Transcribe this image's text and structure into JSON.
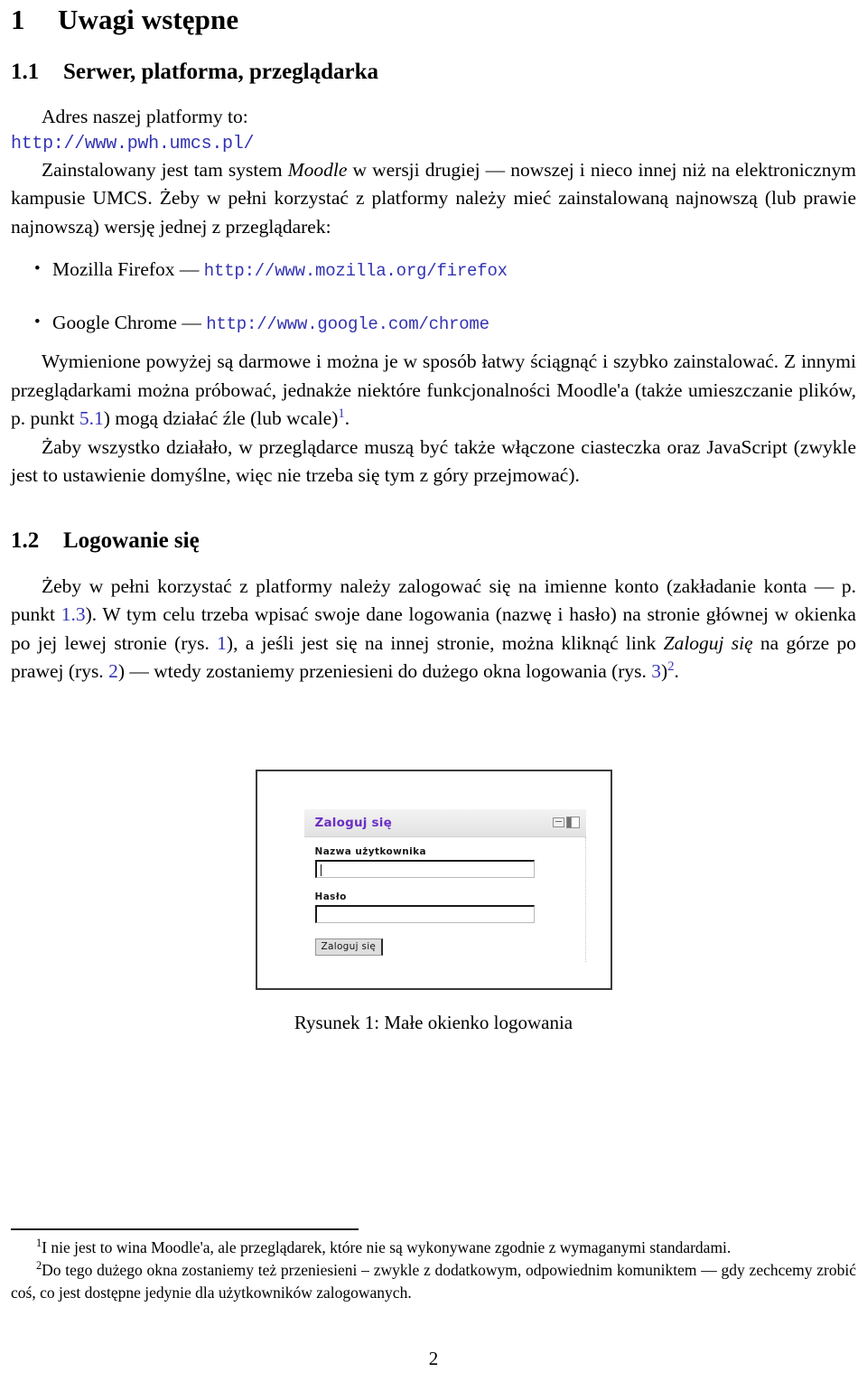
{
  "document": {
    "page_number": "2"
  },
  "section1": {
    "number": "1",
    "title": "Uwagi wstępne"
  },
  "subsection11": {
    "number": "1.1",
    "title": "Serwer, platforma, przeglądarka",
    "intro": "Adres naszej platformy to:",
    "platform_url": "http://www.pwh.umcs.pl/",
    "para1_a": "Zainstalowany jest tam system ",
    "para1_moodle": "Moodle",
    "para1_b": " w wersji drugiej — nowszej i nieco innej niż na elektronicznym kampusie UMCS. Żeby w pełni korzystać z platformy należy mieć zainstalowaną najnowszą (lub prawie najnowszą) wersję jednej z przeglądarek:",
    "browsers": [
      {
        "name": "Mozilla Firefox",
        "dash": " — ",
        "url": "http://www.mozilla.org/firefox"
      },
      {
        "name": "Google Chrome",
        "dash": " — ",
        "url": "http://www.google.com/chrome"
      }
    ],
    "para2_a": "Wymienione powyżej są darmowe i można je w sposób łatwy ściągnąć i szybko zainstalować. Z innymi przeglądarkami można próbować, jednakże niektóre funkcjonalności Moodle'a (także umieszczanie plików, p. punkt ",
    "para2_ref": "5.1",
    "para2_b": ") mogą działać źle (lub wcale)",
    "para2_fn": "1",
    "para2_c": ".",
    "para3": "Żaby wszystko działało, w przeglądarce muszą być także włączone ciasteczka oraz JavaScript (zwykle jest to ustawienie domyślne, więc nie trzeba się tym z góry przejmować)."
  },
  "subsection12": {
    "number": "1.2",
    "title": "Logowanie się",
    "para_a": "Żeby w pełni korzystać z platformy należy zalogować się na imienne konto (zakładanie konta — p. punkt ",
    "ref_13": "1.3",
    "para_b": "). W tym celu trzeba wpisać swoje dane logowania (nazwę i hasło) na stronie głównej w okienka po jej lewej stronie (rys. ",
    "ref_rys1": "1",
    "para_c": "), a jeśli jest się na innej stronie, można kliknąć link ",
    "link_italic": "Zaloguj się",
    "para_d": " na górze po prawej (rys. ",
    "ref_rys2": "2",
    "para_e": ") — wtedy zostaniemy przeniesieni do dużego okna logowania (rys. ",
    "ref_rys3": "3",
    "para_f": ")",
    "para_fn": "2",
    "para_g": "."
  },
  "figure": {
    "caption": "Rysunek 1: Małe okienko logowania",
    "login_panel": {
      "title": "Zaloguj się",
      "username_label": "Nazwa użytkownika",
      "username_value": "",
      "password_label": "Hasło",
      "password_value": "",
      "submit_label": "Zaloguj się",
      "minimize_icon": "minimize-icon",
      "dock_icon": "dock-columns-icon",
      "title_color": "#6a2fc4"
    }
  },
  "footnotes": [
    {
      "mark": "1",
      "text": "I nie jest to wina Moodle'a, ale przeglądarek, które nie są wykonywane zgodnie z wymaganymi standardami."
    },
    {
      "mark": "2",
      "text": "Do tego dużego okna zostaniemy też przeniesieni – zwykle z dodatkowym, odpowiednim komuniktem — gdy zechcemy zrobić coś, co jest dostępne jedynie dla użytkowników zalogowanych."
    }
  ],
  "colors": {
    "link": "#3333b3",
    "panel_title": "#6a2fc4",
    "text": "#000000"
  }
}
